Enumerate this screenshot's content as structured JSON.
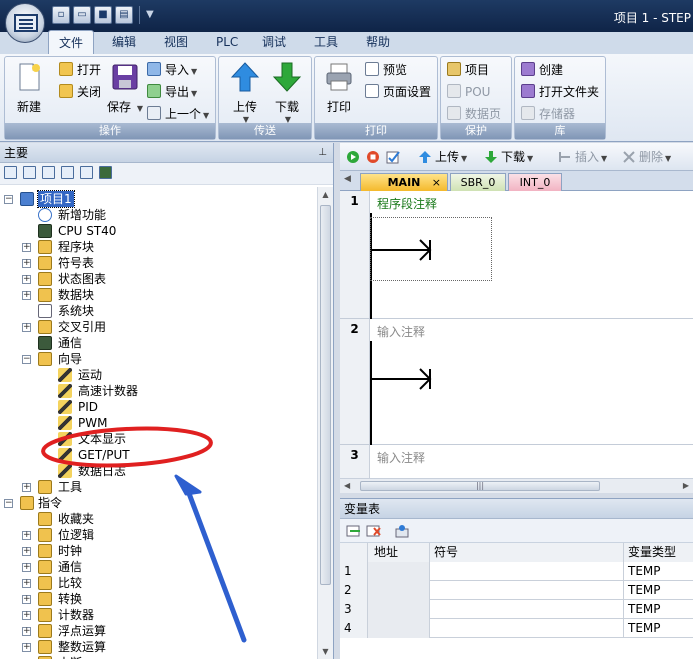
{
  "window": {
    "title": "项目 1 - STEP"
  },
  "ribbon_tabs": [
    "文件",
    "编辑",
    "视图",
    "PLC",
    "调试",
    "工具",
    "帮助"
  ],
  "ribbon": {
    "operate": {
      "label": "操作",
      "new": "新建",
      "open": "打开",
      "close": "关闭",
      "save": "保存",
      "import": "导入",
      "export": "导出",
      "prev": "上一个"
    },
    "transfer": {
      "label": "传送",
      "upload": "上传",
      "download": "下载"
    },
    "print": {
      "label": "打印",
      "print": "打印",
      "preview": "预览",
      "page_setup": "页面设置"
    },
    "protect": {
      "label": "保护",
      "project": "项目",
      "pou": "POU",
      "data_page": "数据页"
    },
    "library": {
      "label": "库",
      "create": "创建",
      "open_folder": "打开文件夹",
      "memory": "存储器"
    }
  },
  "left_panel": {
    "title": "主要",
    "pin_icon": "pin-icon"
  },
  "tree": {
    "project": "项目1",
    "new_features": "新增功能",
    "cpu": "CPU ST40",
    "program_block": "程序块",
    "symbol_table": "符号表",
    "status_chart": "状态图表",
    "data_block": "数据块",
    "system_block": "系统块",
    "cross_ref": "交叉引用",
    "communication": "通信",
    "wizards": "向导",
    "wizard_items": [
      "运动",
      "高速计数器",
      "PID",
      "PWM",
      "文本显示",
      "GET/PUT",
      "数据日志"
    ],
    "tools": "工具",
    "instructions": "指令",
    "instruction_items": [
      "收藏夹",
      "位逻辑",
      "时钟",
      "通信",
      "比较",
      "转换",
      "计数器",
      "浮点运算",
      "整数运算",
      "中断"
    ]
  },
  "editor": {
    "toolbar": {
      "upload": "上传",
      "download": "下载",
      "insert": "插入",
      "delete": "删除"
    },
    "tabs": [
      "MAIN",
      "SBR_0",
      "INT_0"
    ],
    "networks": [
      {
        "num": "1",
        "comment": "程序段注释"
      },
      {
        "num": "2",
        "comment": "输入注释"
      },
      {
        "num": "3",
        "comment": "输入注释"
      }
    ]
  },
  "var_table": {
    "title": "变量表",
    "columns": [
      "地址",
      "符号",
      "变量类型"
    ],
    "rows": [
      {
        "num": "1",
        "type": "TEMP"
      },
      {
        "num": "2",
        "type": "TEMP"
      },
      {
        "num": "3",
        "type": "TEMP"
      },
      {
        "num": "4",
        "type": "TEMP"
      }
    ]
  },
  "colors": {
    "title_bar": "#0f2447",
    "ribbon_group_label": "#8096b6",
    "selection": "#3367c4",
    "comment_green": "#1a7a1a",
    "comment_gray": "#8a8a8a",
    "annotation_red": "#e02020",
    "annotation_blue": "#2e5fcf"
  }
}
